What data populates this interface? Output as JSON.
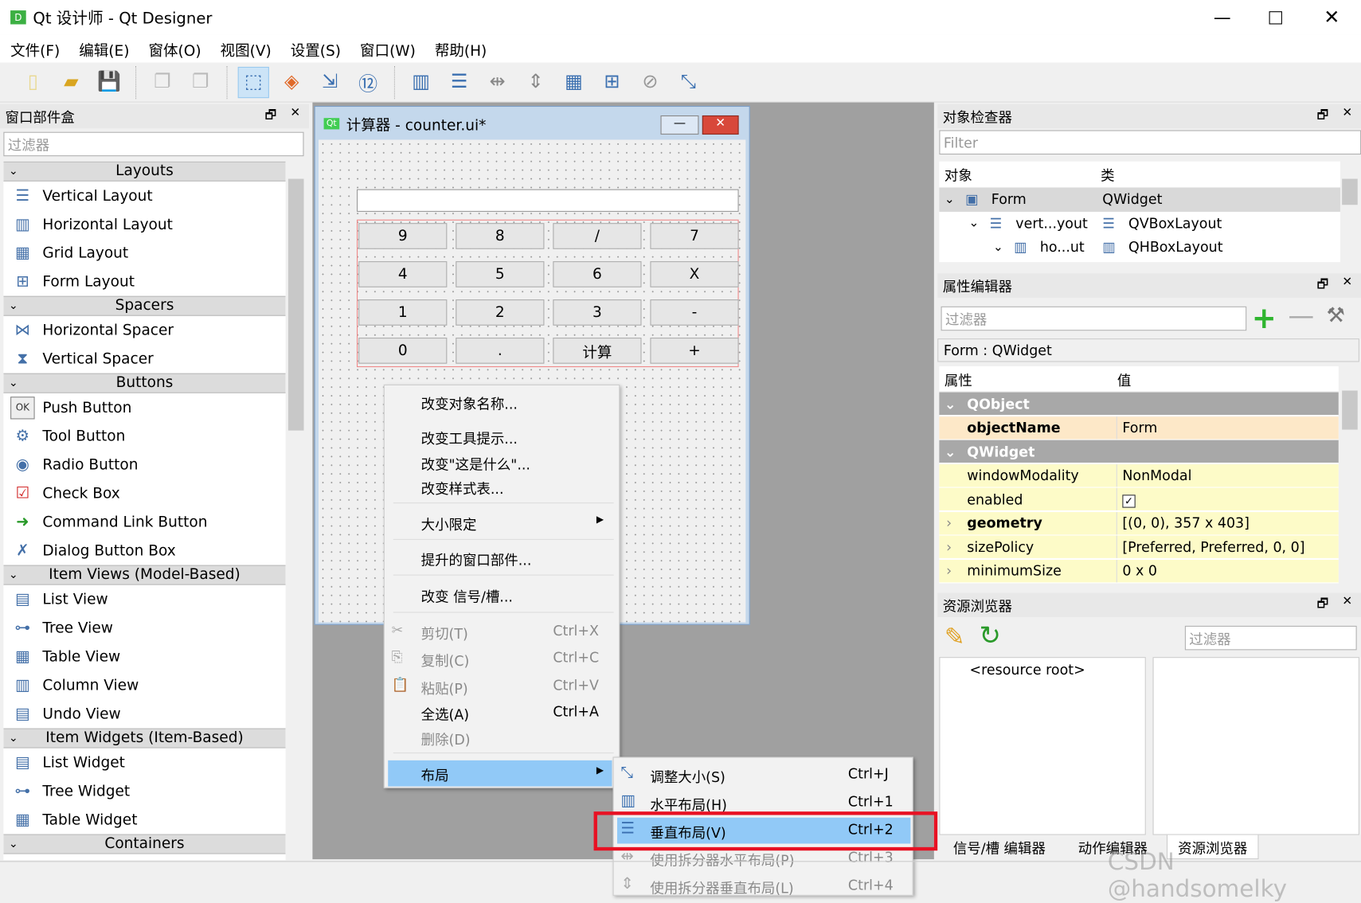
{
  "window": {
    "title": "Qt 设计师 - Qt Designer",
    "app_icon": "qt-designer-icon"
  },
  "menubar": [
    "文件(F)",
    "编辑(E)",
    "窗体(O)",
    "视图(V)",
    "设置(S)",
    "窗口(W)",
    "帮助(H)"
  ],
  "widget_box": {
    "title": "窗口部件盒",
    "filter_placeholder": "过滤器",
    "categories": [
      {
        "label": "Layouts",
        "items": [
          "Vertical Layout",
          "Horizontal Layout",
          "Grid Layout",
          "Form Layout"
        ]
      },
      {
        "label": "Spacers",
        "items": [
          "Horizontal Spacer",
          "Vertical Spacer"
        ]
      },
      {
        "label": "Buttons",
        "items": [
          "Push Button",
          "Tool Button",
          "Radio Button",
          "Check Box",
          "Command Link Button",
          "Dialog Button Box"
        ]
      },
      {
        "label": "Item Views (Model-Based)",
        "items": [
          "List View",
          "Tree View",
          "Table View",
          "Column View",
          "Undo View"
        ]
      },
      {
        "label": "Item Widgets (Item-Based)",
        "items": [
          "List Widget",
          "Tree Widget",
          "Table Widget"
        ]
      },
      {
        "label": "Containers",
        "items": []
      }
    ]
  },
  "form": {
    "title": "计算器 - counter.ui*",
    "buttons": [
      [
        "9",
        "8",
        "/",
        "7"
      ],
      [
        "4",
        "5",
        "6",
        "X"
      ],
      [
        "1",
        "2",
        "3",
        "-"
      ],
      [
        "0",
        ".",
        "计算",
        "+"
      ]
    ]
  },
  "context_menu": {
    "items": [
      {
        "label": "改变对象名称..."
      },
      {
        "label": "改变工具提示..."
      },
      {
        "label": "改变\"这是什么\"..."
      },
      {
        "label": "改变样式表..."
      },
      {
        "label": "大小限定",
        "submenu": true
      },
      {
        "label": "提升的窗口部件..."
      },
      {
        "label": "改变 信号/槽..."
      },
      {
        "label": "剪切(T)",
        "shortcut": "Ctrl+X",
        "disabled": true
      },
      {
        "label": "复制(C)",
        "shortcut": "Ctrl+C",
        "disabled": true
      },
      {
        "label": "粘贴(P)",
        "shortcut": "Ctrl+V",
        "disabled": true
      },
      {
        "label": "全选(A)",
        "shortcut": "Ctrl+A"
      },
      {
        "label": "删除(D)",
        "disabled": true
      },
      {
        "label": "布局",
        "submenu": true,
        "highlighted": true
      }
    ]
  },
  "layout_submenu": {
    "items": [
      {
        "label": "调整大小(S)",
        "shortcut": "Ctrl+J"
      },
      {
        "label": "水平布局(H)",
        "shortcut": "Ctrl+1"
      },
      {
        "label": "垂直布局(V)",
        "shortcut": "Ctrl+2",
        "highlighted": true
      },
      {
        "label": "使用拆分器水平布局(P)",
        "shortcut": "Ctrl+3",
        "disabled": true
      },
      {
        "label": "使用拆分器垂直布局(L)",
        "shortcut": "Ctrl+4",
        "disabled": true
      }
    ],
    "highlight_box_color": "#e81123"
  },
  "object_inspector": {
    "title": "对象检查器",
    "filter_placeholder": "Filter",
    "columns": [
      "对象",
      "类"
    ],
    "rows": [
      {
        "object": "Form",
        "class": "QWidget"
      },
      {
        "object": "vert...yout",
        "class": "QVBoxLayout"
      },
      {
        "object": "ho...ut",
        "class": "QHBoxLayout"
      }
    ]
  },
  "property_editor": {
    "title": "属性编辑器",
    "filter_placeholder": "过滤器",
    "context": "Form : QWidget",
    "columns": [
      "属性",
      "值"
    ],
    "rows": [
      {
        "group": "QObject"
      },
      {
        "name": "objectName",
        "value": "Form",
        "bold": true
      },
      {
        "group": "QWidget"
      },
      {
        "name": "windowModality",
        "value": "NonModal"
      },
      {
        "name": "enabled",
        "value": "",
        "checked": true
      },
      {
        "name": "geometry",
        "value": "[(0, 0), 357 x 403]",
        "bold": true,
        "expandable": true
      },
      {
        "name": "sizePolicy",
        "value": "[Preferred, Preferred, 0, 0]",
        "expandable": true
      },
      {
        "name": "minimumSize",
        "value": "0 x 0",
        "expandable": true
      }
    ]
  },
  "resource_browser": {
    "title": "资源浏览器",
    "filter_placeholder": "过滤器",
    "root": "<resource root>"
  },
  "bottom_tabs": [
    "信号/槽 编辑器",
    "动作编辑器",
    "资源浏览器"
  ],
  "watermark": "CSDN @handsomelky"
}
